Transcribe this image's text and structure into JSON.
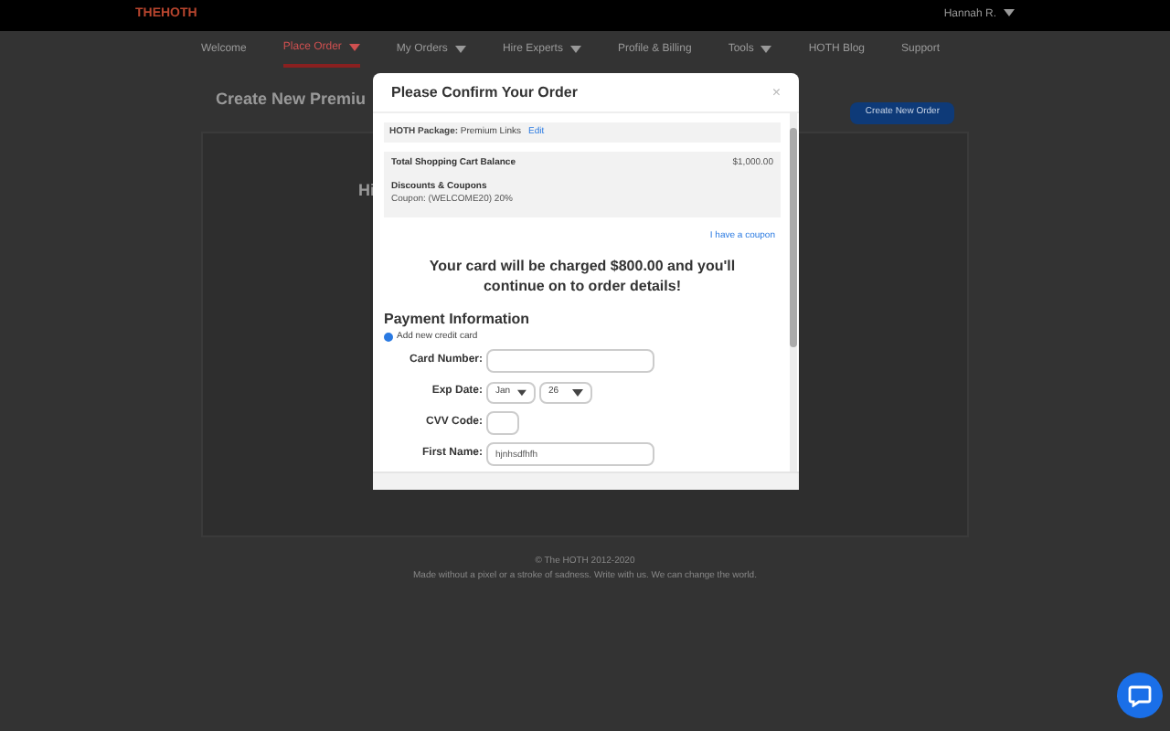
{
  "header": {
    "logo": "THEHOTH",
    "user": "Hannah R."
  },
  "nav": [
    {
      "label": "Welcome",
      "selected": false,
      "dropdown": false
    },
    {
      "label": "Place Order",
      "selected": true,
      "dropdown": true
    },
    {
      "label": "My Orders",
      "selected": false,
      "dropdown": true
    },
    {
      "label": "Hire Experts",
      "selected": false,
      "dropdown": true
    },
    {
      "label": "Profile & Billing",
      "selected": false,
      "dropdown": false
    },
    {
      "label": "Tools",
      "selected": false,
      "dropdown": true
    },
    {
      "label": "HOTH Blog",
      "selected": false,
      "dropdown": false
    },
    {
      "label": "Support",
      "selected": false,
      "dropdown": false
    }
  ],
  "page": {
    "title": "Create New Premiu",
    "create_button": "Create New Order",
    "greeting": "Hi"
  },
  "footer": {
    "copyright": "© The HOTH 2012-2020",
    "tagline": "Made without a pixel or a stroke of sadness. Write with us. We can change the world."
  },
  "modal": {
    "title": "Please Confirm Your Order",
    "close": "×",
    "package_label": "HOTH Package:",
    "package_value": "Premium Links",
    "edit_link": "Edit",
    "total_label": "Total Shopping Cart Balance",
    "total_value": "$1,000.00",
    "discounts_label": "Discounts & Coupons",
    "coupon": "Coupon: (WELCOME20) 20%",
    "coupon_link": "I have a coupon",
    "charge_message": "Your card will be charged $800.00 and you'll continue on to order details!",
    "payment_heading": "Payment Information",
    "payment_option": {
      "label": "Add new credit card",
      "selected": true
    },
    "fields": [
      {
        "kind": "text",
        "label": "Card Number:"
      },
      {
        "kind": "date",
        "label": "Exp Date:",
        "month": "Jan",
        "year": "26"
      },
      {
        "kind": "short",
        "label": "CVV Code:"
      },
      {
        "kind": "text",
        "label": "First Name:",
        "value": "hjnhsdfhfh"
      }
    ]
  }
}
